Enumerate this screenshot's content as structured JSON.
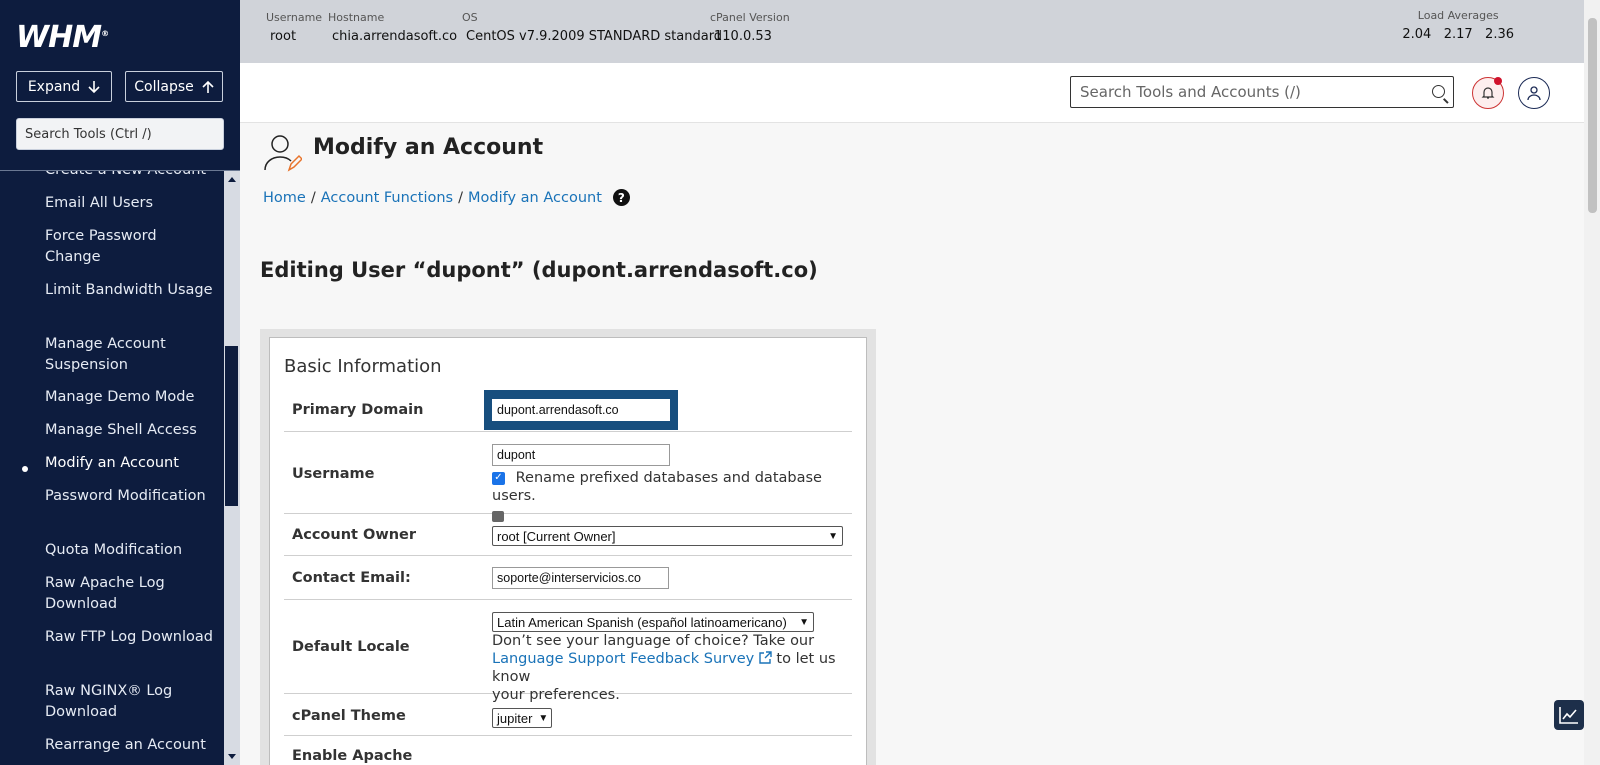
{
  "sidebar": {
    "logo": "WHM",
    "logo_mark": "®",
    "expand_label": "Expand",
    "collapse_label": "Collapse",
    "search_placeholder": "Search Tools (Ctrl /)",
    "items": [
      {
        "label": "Create a New Account"
      },
      {
        "label": "Email All Users"
      },
      {
        "label": "Force Password Change"
      },
      {
        "label": "Limit Bandwidth Usage"
      },
      {
        "label": "Manage Account Suspension"
      },
      {
        "label": "Manage Demo Mode"
      },
      {
        "label": "Manage Shell Access"
      },
      {
        "label": "Modify an Account"
      },
      {
        "label": "Password Modification"
      },
      {
        "label": "Quota Modification"
      },
      {
        "label": "Raw Apache Log Download"
      },
      {
        "label": "Raw FTP Log Download"
      },
      {
        "label": "Raw NGINX® Log Download"
      },
      {
        "label": "Rearrange an Account"
      }
    ]
  },
  "infobar": {
    "username_label": "Username",
    "username": "root",
    "hostname_label": "Hostname",
    "hostname": "chia.arrendasoft.co",
    "os_label": "OS",
    "os": "CentOS v7.9.2009 STANDARD standard",
    "cpanel_label": "cPanel Version",
    "cpanel": "110.0.53",
    "load_label": "Load Averages",
    "load": "2.04   2.17   2.36"
  },
  "header": {
    "search_placeholder": "Search Tools and Accounts (/)"
  },
  "page": {
    "title": "Modify an Account",
    "breadcrumb": [
      "Home",
      "Account Functions",
      "Modify an Account"
    ],
    "breadcrumb_sep": "/",
    "help": "?",
    "editing": "Editing User “dupont” (dupont.arrendasoft.co)"
  },
  "form": {
    "section": "Basic Information",
    "primary_domain_label": "Primary Domain",
    "primary_domain": "dupont.arrendasoft.co",
    "username_label": "Username",
    "username": "dupont",
    "rename_label": "Rename prefixed databases and database users.",
    "owner_label": "Account Owner",
    "owner": "root [Current Owner]",
    "email_label": "Contact Email:",
    "email": "soporte@interservicios.co",
    "locale_label": "Default Locale",
    "locale": "Latin American Spanish (español latinoamericano)",
    "locale_note_1": "Don’t see your language of choice? Take our",
    "locale_link": "Language Support Feedback Survey",
    "locale_note_2": "to let us know",
    "locale_note_3": "your preferences.",
    "theme_label": "cPanel Theme",
    "theme": "jupiter",
    "apache_label": "Enable Apache"
  }
}
